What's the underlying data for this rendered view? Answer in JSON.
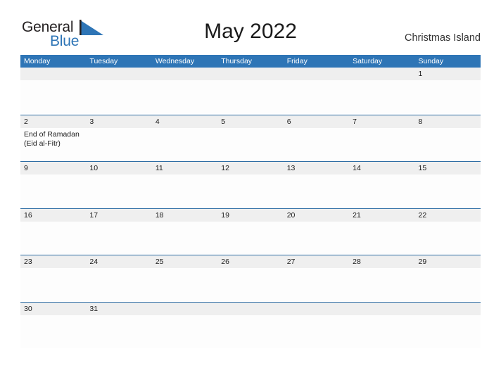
{
  "brand": {
    "name_top": "General",
    "name_bottom": "Blue",
    "flag_icon": "blue-flag-triangle-icon",
    "color_dark": "#231f20",
    "color_blue": "#2e75b6"
  },
  "header": {
    "title": "May 2022",
    "location": "Christmas Island"
  },
  "theme": {
    "header_blue": "#2e75b6",
    "row_border_blue": "#2e6da4",
    "number_band_gray": "#efefef",
    "cell_white": "#fdfdfd",
    "text_dark": "#1a1a1a"
  },
  "calendar": {
    "weekdays": [
      "Monday",
      "Tuesday",
      "Wednesday",
      "Thursday",
      "Friday",
      "Saturday",
      "Sunday"
    ],
    "weeks": [
      {
        "days": [
          {
            "number": "",
            "events": []
          },
          {
            "number": "",
            "events": []
          },
          {
            "number": "",
            "events": []
          },
          {
            "number": "",
            "events": []
          },
          {
            "number": "",
            "events": []
          },
          {
            "number": "",
            "events": []
          },
          {
            "number": "1",
            "events": []
          }
        ]
      },
      {
        "days": [
          {
            "number": "2",
            "events": [
              "End of Ramadan",
              "(Eid al-Fitr)"
            ]
          },
          {
            "number": "3",
            "events": []
          },
          {
            "number": "4",
            "events": []
          },
          {
            "number": "5",
            "events": []
          },
          {
            "number": "6",
            "events": []
          },
          {
            "number": "7",
            "events": []
          },
          {
            "number": "8",
            "events": []
          }
        ]
      },
      {
        "days": [
          {
            "number": "9",
            "events": []
          },
          {
            "number": "10",
            "events": []
          },
          {
            "number": "11",
            "events": []
          },
          {
            "number": "12",
            "events": []
          },
          {
            "number": "13",
            "events": []
          },
          {
            "number": "14",
            "events": []
          },
          {
            "number": "15",
            "events": []
          }
        ]
      },
      {
        "days": [
          {
            "number": "16",
            "events": []
          },
          {
            "number": "17",
            "events": []
          },
          {
            "number": "18",
            "events": []
          },
          {
            "number": "19",
            "events": []
          },
          {
            "number": "20",
            "events": []
          },
          {
            "number": "21",
            "events": []
          },
          {
            "number": "22",
            "events": []
          }
        ]
      },
      {
        "days": [
          {
            "number": "23",
            "events": []
          },
          {
            "number": "24",
            "events": []
          },
          {
            "number": "25",
            "events": []
          },
          {
            "number": "26",
            "events": []
          },
          {
            "number": "27",
            "events": []
          },
          {
            "number": "28",
            "events": []
          },
          {
            "number": "29",
            "events": []
          }
        ]
      },
      {
        "days": [
          {
            "number": "30",
            "events": []
          },
          {
            "number": "31",
            "events": []
          },
          {
            "number": "",
            "events": []
          },
          {
            "number": "",
            "events": []
          },
          {
            "number": "",
            "events": []
          },
          {
            "number": "",
            "events": []
          },
          {
            "number": "",
            "events": []
          }
        ]
      }
    ]
  }
}
